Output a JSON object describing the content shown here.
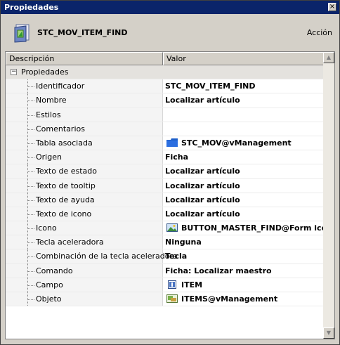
{
  "window": {
    "title": "Propiedades",
    "close_glyph": "×"
  },
  "header": {
    "object_name": "STC_MOV_ITEM_FIND",
    "action_label": "Acción",
    "icon": "action-object-icon"
  },
  "grid": {
    "columns": [
      "Descripción",
      "Valor"
    ],
    "group": {
      "label": "Propiedades",
      "expander": "−"
    },
    "rows": [
      {
        "label": "Identificador",
        "value": "STC_MOV_ITEM_FIND",
        "icon": null
      },
      {
        "label": "Nombre",
        "value": "Localizar artículo",
        "icon": null
      },
      {
        "label": "Estilos",
        "value": "",
        "icon": null
      },
      {
        "label": "Comentarios",
        "value": "",
        "icon": null
      },
      {
        "label": "Tabla asociada",
        "value": "STC_MOV@vManagement",
        "icon": "folder-icon"
      },
      {
        "label": "Origen",
        "value": "Ficha",
        "icon": null
      },
      {
        "label": "Texto de estado",
        "value": "Localizar artículo",
        "icon": null
      },
      {
        "label": "Texto de tooltip",
        "value": "Localizar artículo",
        "icon": null
      },
      {
        "label": "Texto de ayuda",
        "value": "Localizar artículo",
        "icon": null
      },
      {
        "label": "Texto de icono",
        "value": "Localizar artículo",
        "icon": null
      },
      {
        "label": "Icono",
        "value": "BUTTON_MASTER_FIND@Form icons",
        "icon": "image-icon"
      },
      {
        "label": "Tecla aceleradora",
        "value": "Ninguna",
        "icon": null
      },
      {
        "label": "Combinación de la tecla aceleradora",
        "value": "Tecla",
        "icon": null
      },
      {
        "label": "Comando",
        "value": "Ficha: Localizar maestro",
        "icon": null
      },
      {
        "label": "Campo",
        "value": "ITEM",
        "icon": "field-icon"
      },
      {
        "label": "Objeto",
        "value": "ITEMS@vManagement",
        "icon": "object-icon"
      }
    ]
  },
  "scrollbar": {
    "up_glyph": "▲",
    "down_glyph": "▼"
  },
  "colors": {
    "titlebar": "#0a246a",
    "folder": "#1d5fc9"
  }
}
